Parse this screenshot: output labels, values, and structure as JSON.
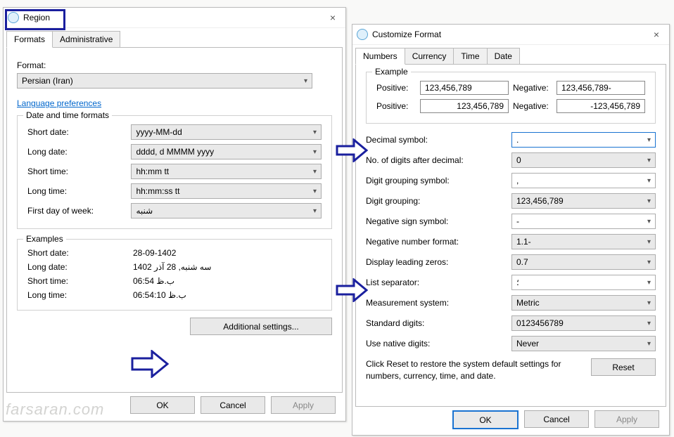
{
  "region": {
    "title": "Region",
    "tabs": {
      "formats": "Formats",
      "admin": "Administrative"
    },
    "format_label": "Format:",
    "format_value": "Persian (Iran)",
    "language_pref": "Language preferences",
    "dt_group": "Date and time formats",
    "short_date_l": "Short date:",
    "short_date_v": "yyyy-MM-dd",
    "long_date_l": "Long date:",
    "long_date_v": "dddd, d MMMM yyyy",
    "short_time_l": "Short time:",
    "short_time_v": "hh:mm tt",
    "long_time_l": "Long time:",
    "long_time_v": "hh:mm:ss tt",
    "first_day_l": "First day of week:",
    "first_day_v": "شنبه",
    "ex_group": "Examples",
    "ex_sd_l": "Short date:",
    "ex_sd_v": "28-09-1402",
    "ex_ld_l": "Long date:",
    "ex_ld_v": "سه شنبه, 28 آذر 1402",
    "ex_st_l": "Short time:",
    "ex_st_v": "06:54 ب.ظ",
    "ex_lt_l": "Long time:",
    "ex_lt_v": "06:54:10 ب.ظ",
    "additional_btn": "Additional settings...",
    "ok": "OK",
    "cancel": "Cancel",
    "apply": "Apply"
  },
  "customize": {
    "title": "Customize Format",
    "tabs": {
      "numbers": "Numbers",
      "currency": "Currency",
      "time": "Time",
      "date": "Date"
    },
    "example_group": "Example",
    "positive_l": "Positive:",
    "negative_l": "Negative:",
    "pos1": "123,456,789",
    "neg1": "123,456,789-",
    "pos2": "123,456,789",
    "neg2": "-123,456,789",
    "decimal_l": "Decimal symbol:",
    "decimal_v": ".",
    "digits_after_l": "No. of digits after decimal:",
    "digits_after_v": "0",
    "group_sym_l": "Digit grouping symbol:",
    "group_sym_v": ",",
    "grouping_l": "Digit grouping:",
    "grouping_v": "123,456,789",
    "neg_sym_l": "Negative sign symbol:",
    "neg_sym_v": "-",
    "neg_fmt_l": "Negative number format:",
    "neg_fmt_v": "1.1-",
    "lead_zero_l": "Display leading zeros:",
    "lead_zero_v": "0.7",
    "list_sep_l": "List separator:",
    "list_sep_v": "؛",
    "measure_l": "Measurement system:",
    "measure_v": "Metric",
    "std_digits_l": "Standard digits:",
    "std_digits_v": "0123456789",
    "native_l": "Use native digits:",
    "native_v": "Never",
    "reset_text": "Click Reset to restore the system default settings for numbers, currency, time, and date.",
    "reset_btn": "Reset",
    "ok": "OK",
    "cancel": "Cancel",
    "apply": "Apply"
  },
  "watermark": "farsaran.com"
}
